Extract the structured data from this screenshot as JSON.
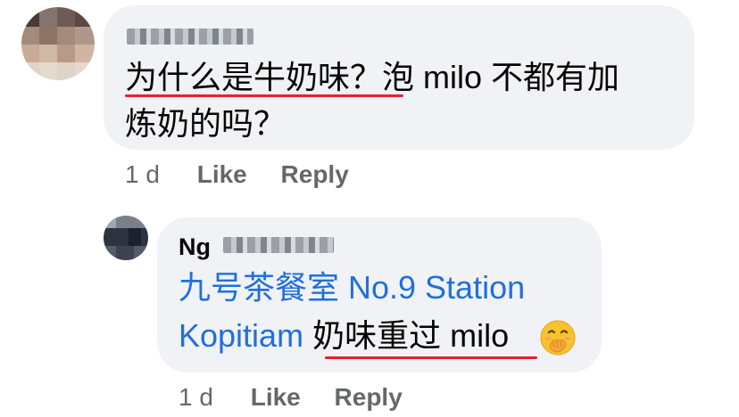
{
  "comments": [
    {
      "author_visible": "",
      "text_line1_underlined": "为什么是牛奶味？",
      "text_line1_rest": "泡 milo 不都有加",
      "text_line2": "炼奶的吗？",
      "time": "1 d",
      "like_label": "Like",
      "reply_label": "Reply"
    },
    {
      "author_visible": "Ng",
      "mention_line1": "九号茶餐室 No.9 Station",
      "mention_line2": "Kopitiam",
      "text_underlined": "奶味重过 milo",
      "emoji_name": "face-with-hand-over-mouth-icon",
      "time": "1 d",
      "like_label": "Like",
      "reply_label": "Reply"
    }
  ],
  "colors": {
    "bubble_bg": "#f0f2f5",
    "mention": "#216fdb",
    "underline": "#e0242b",
    "meta_text": "#65676b"
  }
}
